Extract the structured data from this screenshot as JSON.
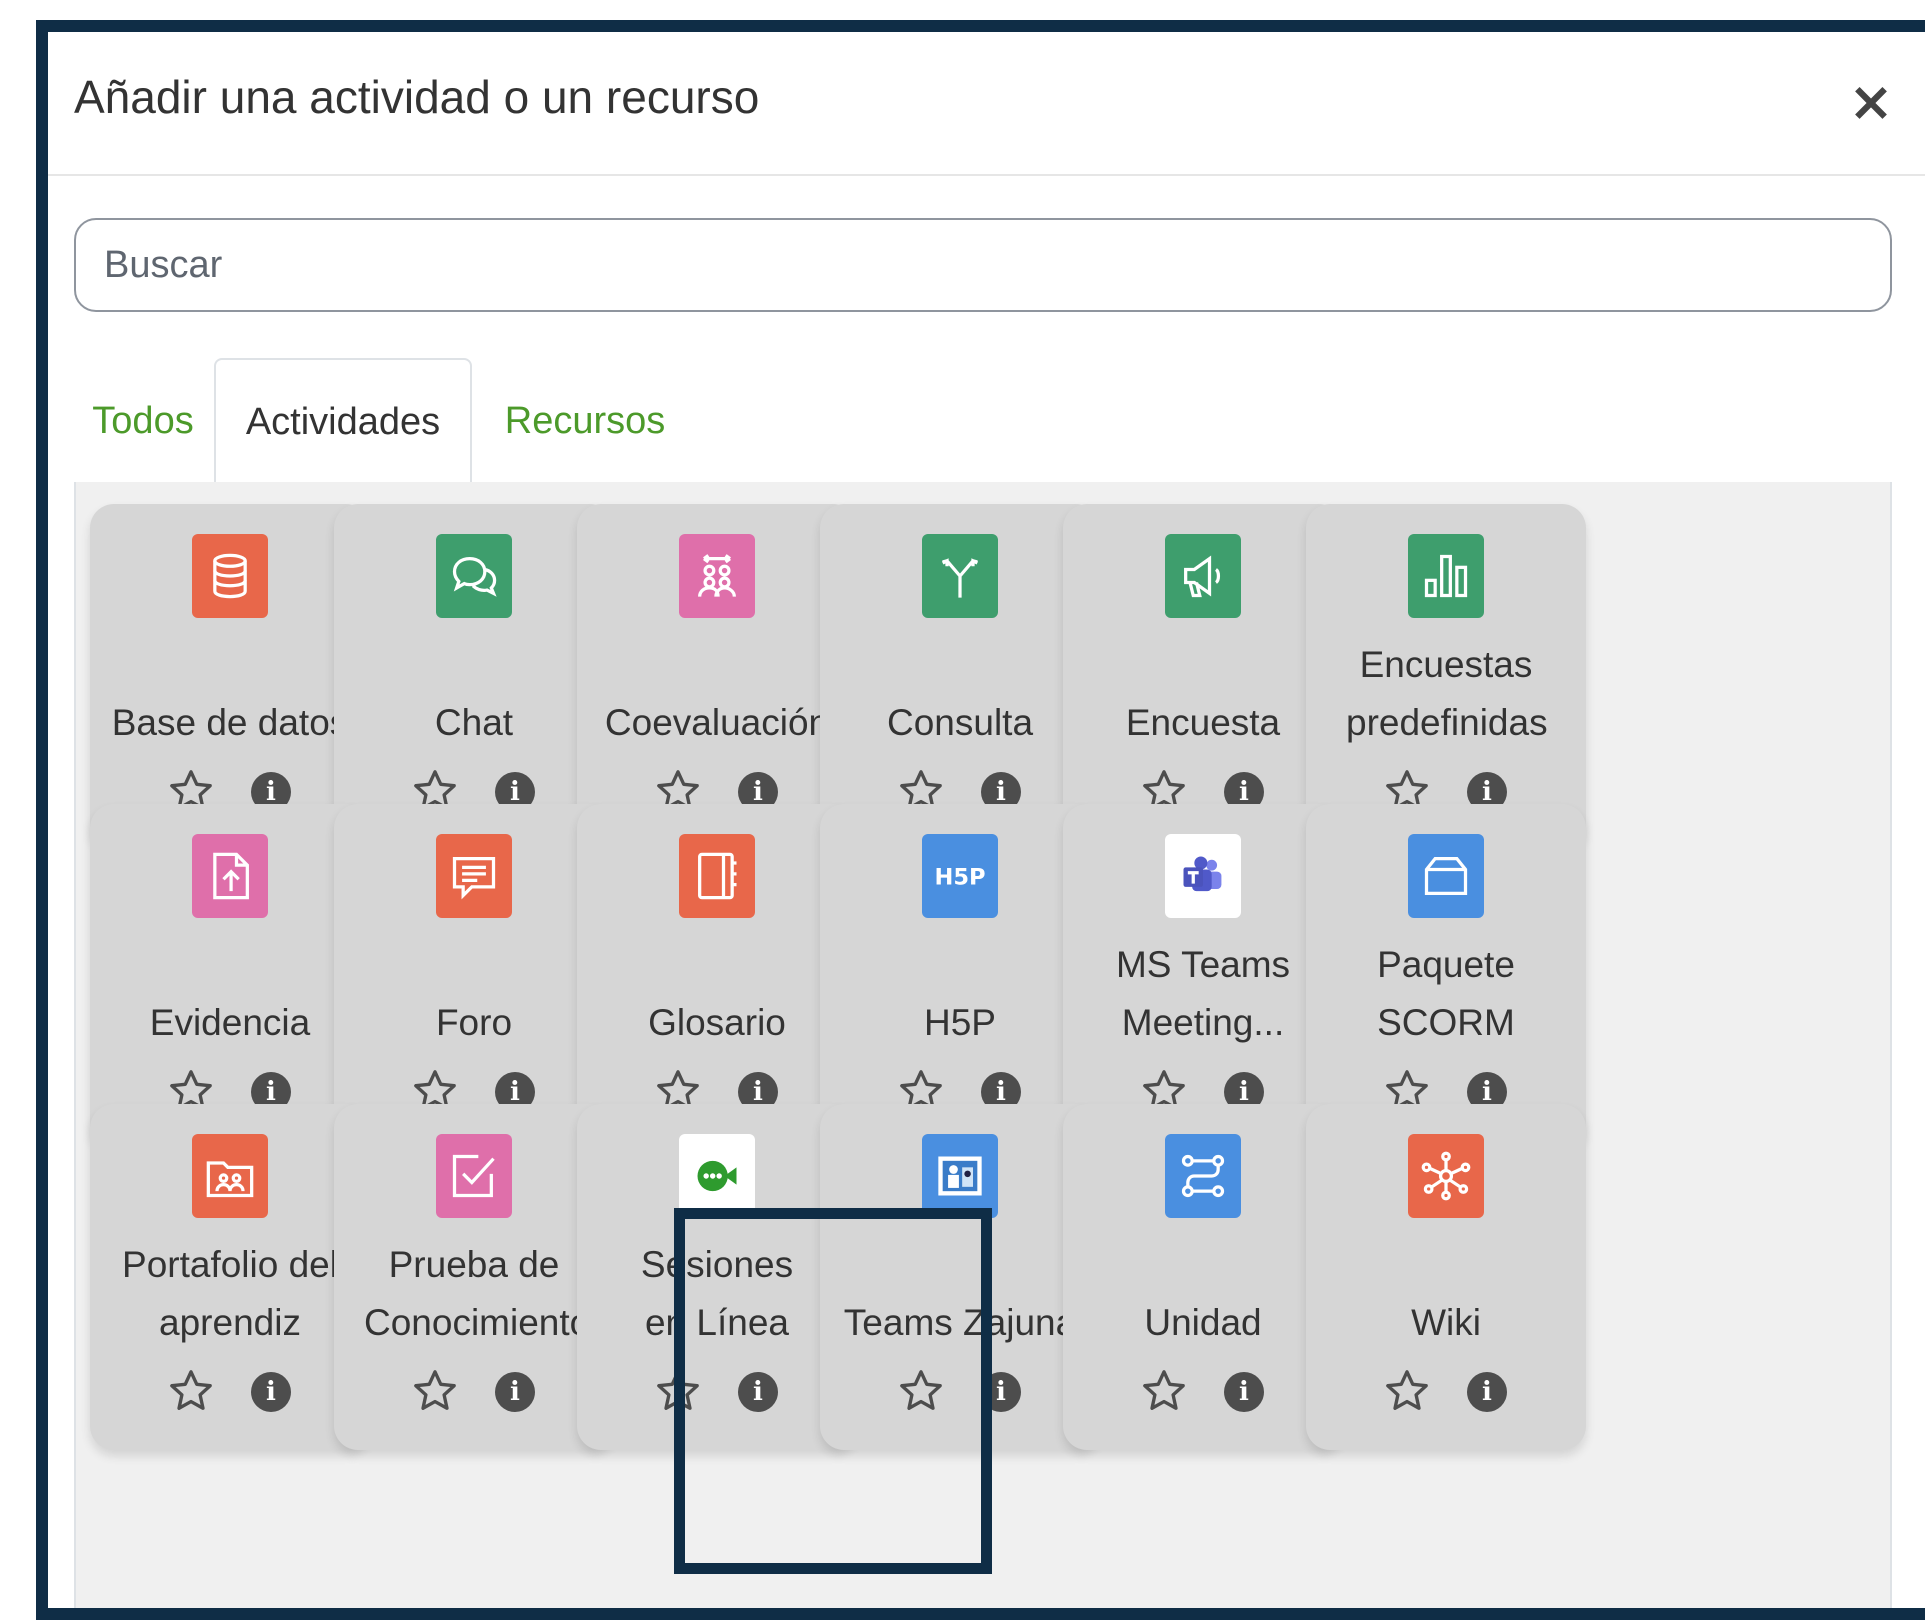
{
  "dialog": {
    "title": "Añadir una actividad o un recurso",
    "close_label": "×"
  },
  "search": {
    "placeholder": "Buscar"
  },
  "tabs": [
    {
      "label": "Todos",
      "active": false
    },
    {
      "label": "Actividades",
      "active": true
    },
    {
      "label": "Recursos",
      "active": false
    }
  ],
  "colors": {
    "accent_green": "#4c9a2a",
    "frame": "#0f2d46",
    "card_bg": "#d6d6d6"
  },
  "activities": [
    {
      "label": "Base de datos",
      "icon": "database-icon",
      "color": "#e8674a"
    },
    {
      "label": "Chat",
      "icon": "chat-bubbles-icon",
      "color": "#3e9e6d"
    },
    {
      "label": "Coevaluación",
      "icon": "peer-review-icon",
      "color": "#df6faa"
    },
    {
      "label": "Consulta",
      "icon": "choice-signpost-icon",
      "color": "#3e9e6d"
    },
    {
      "label": "Encuesta",
      "icon": "megaphone-icon",
      "color": "#3e9e6d"
    },
    {
      "label": "Encuestas predefinidas",
      "icon": "bar-chart-icon",
      "color": "#3e9e6d"
    },
    {
      "label": "Evidencia",
      "icon": "file-upload-icon",
      "color": "#df6faa"
    },
    {
      "label": "Foro",
      "icon": "forum-icon",
      "color": "#e8674a"
    },
    {
      "label": "Glosario",
      "icon": "book-icon",
      "color": "#e8674a"
    },
    {
      "label": "H5P",
      "icon": "h5p-icon",
      "color": "#4a8fe0"
    },
    {
      "label": "MS Teams Meeting...",
      "icon": "ms-teams-icon",
      "color": "#ffffff"
    },
    {
      "label": "Paquete SCORM",
      "icon": "package-icon",
      "color": "#4a8fe0"
    },
    {
      "label": "Portafolio del aprendiz",
      "icon": "portfolio-folder-icon",
      "color": "#e8674a"
    },
    {
      "label": "Prueba de Conocimiento",
      "icon": "quiz-check-icon",
      "color": "#df6faa"
    },
    {
      "label": "Sesiones en Línea",
      "icon": "video-chat-icon",
      "color": "#ffffff"
    },
    {
      "label": "Teams Zajuna",
      "icon": "teams-zajuna-icon",
      "color": "#4a8fe0"
    },
    {
      "label": "Unidad",
      "icon": "route-icon",
      "color": "#4a8fe0"
    },
    {
      "label": "Wiki",
      "icon": "wiki-network-icon",
      "color": "#e8674a"
    }
  ],
  "card_actions": {
    "star_icon": "star-outline-icon",
    "info_icon": "info-icon",
    "info_glyph": "i"
  },
  "highlighted_item": "Sesiones en Línea"
}
